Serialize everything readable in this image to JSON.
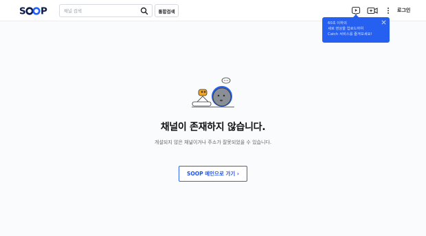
{
  "header": {
    "logo_text": "SOOP",
    "search_placeholder": "채널 검색",
    "search_icon": "search-icon",
    "total_search_label": "통합검색",
    "login_label": "로그인",
    "icons": [
      "catch-icon",
      "video-camera-icon",
      "more-icon"
    ]
  },
  "tooltip": {
    "lines": [
      "60초 이하의",
      "세로 영상을 업로드하여",
      "Catch 서비스를 즐겨보세요!"
    ],
    "close_icon": "close-icon"
  },
  "main": {
    "title": "채널이 존재하지 않습니다.",
    "description": "개설되지 않은 채널이거나 주소가 잘못되었을 수 있습니다.",
    "home_button_label": "SOOP 메인으로 가기 ›"
  },
  "colors": {
    "brand_blue": "#2560f0",
    "logo_navy": "#0a1a4a"
  }
}
